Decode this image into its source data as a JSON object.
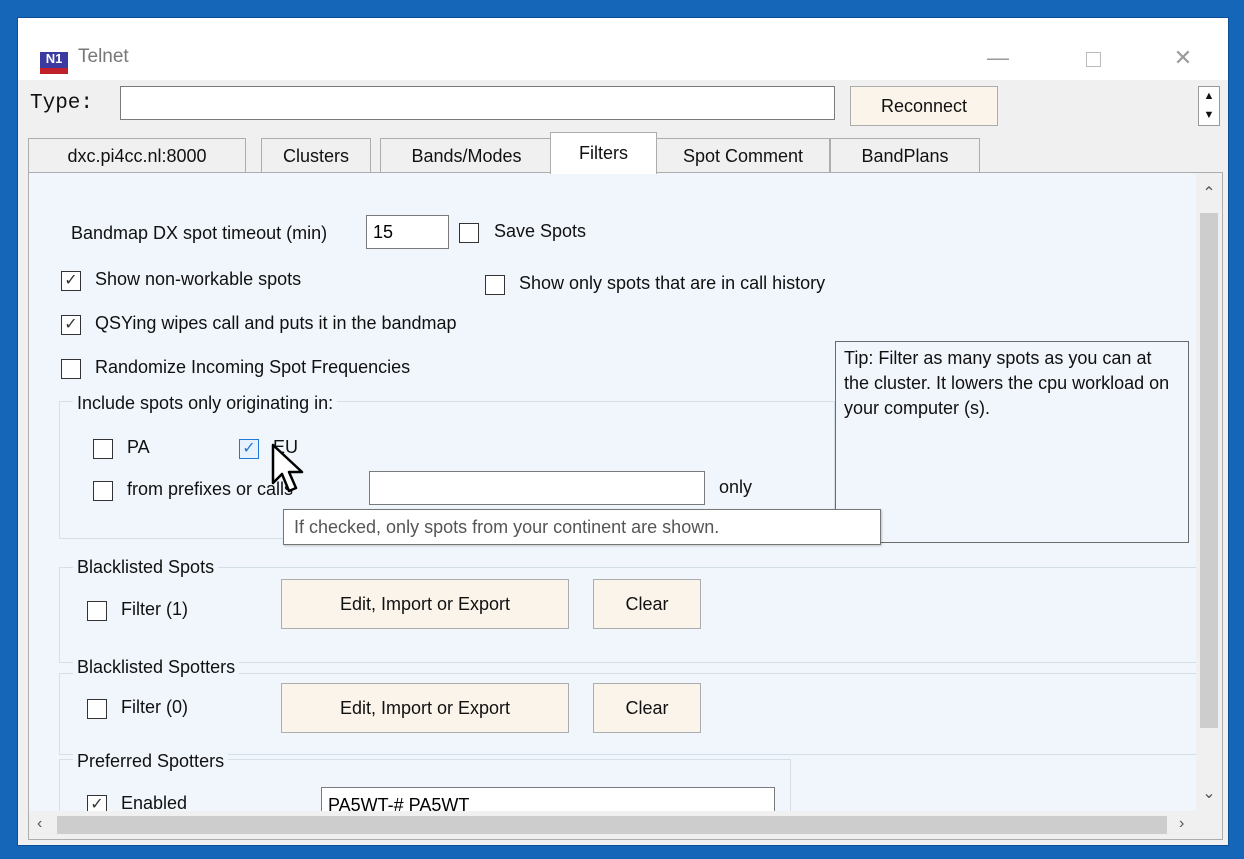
{
  "window": {
    "title": "Telnet",
    "icon": "n1mm-logo-icon",
    "icon_text": "N1"
  },
  "typebar": {
    "label": "Type:",
    "value": "",
    "reconnect_label": "Reconnect"
  },
  "tabs": [
    {
      "label": "dxc.pi4cc.nl:8000",
      "active": false
    },
    {
      "label": "Clusters",
      "active": false
    },
    {
      "label": "Bands/Modes",
      "active": false
    },
    {
      "label": "Filters",
      "active": true
    },
    {
      "label": "Spot Comment",
      "active": false
    },
    {
      "label": "BandPlans",
      "active": false
    }
  ],
  "filters": {
    "timeout_label": "Bandmap DX spot timeout (min)",
    "timeout_value": "15",
    "save_spots": {
      "label": "Save Spots",
      "checked": false
    },
    "show_nonworkable": {
      "label": "Show non-workable spots",
      "checked": true
    },
    "show_history": {
      "label": "Show only spots that are in call history",
      "checked": false
    },
    "qsy_wipes": {
      "label": "QSYing wipes call and puts it in the bandmap",
      "checked": true
    },
    "randomize": {
      "label": "Randomize Incoming Spot Frequencies",
      "checked": false
    },
    "tip": "Tip: Filter as many spots as you can at the cluster.  It lowers the cpu workload  on your computer (s).",
    "origin": {
      "title": "Include spots only originating in:",
      "pa": {
        "label": "PA",
        "checked": false
      },
      "eu": {
        "label": "EU",
        "checked": true
      },
      "prefixes": {
        "label": "from prefixes or calls",
        "checked": false,
        "value": ""
      },
      "only_label": "only",
      "tooltip": "If checked, only spots from your continent are shown."
    },
    "blacklisted_spots": {
      "title": "Blacklisted Spots",
      "filter_label": "Filter (1)",
      "checked": false,
      "edit_label": "Edit, Import or Export",
      "clear_label": "Clear"
    },
    "blacklisted_spotters": {
      "title": "Blacklisted Spotters",
      "filter_label": "Filter (0)",
      "checked": false,
      "edit_label": "Edit, Import or Export",
      "clear_label": "Clear"
    },
    "preferred_spotters": {
      "title": "Preferred Spotters",
      "enabled_label": "Enabled",
      "checked": true,
      "value": "PA5WT-# PA5WT"
    }
  },
  "colors": {
    "desktop": "#1565b8",
    "panel": "#f0f6fb",
    "button": "#fbf4ea",
    "check_blue": "#1f7ad6"
  }
}
